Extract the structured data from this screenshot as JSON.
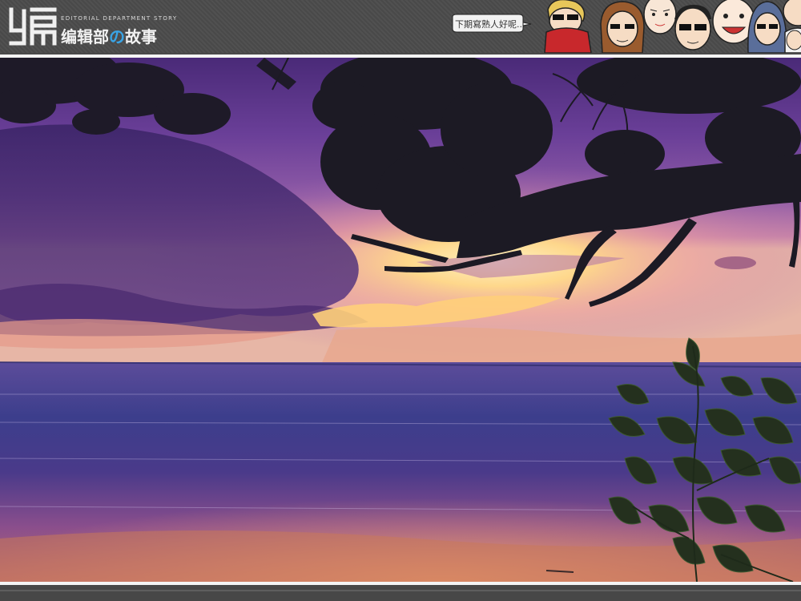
{
  "header": {
    "logo_char": "编",
    "tagline": "EDITORIAL DEPARTMENT STORY",
    "title_part1": "编辑部",
    "title_accent": "の",
    "title_part2": "故事",
    "speech_bubble": "下期寫熟人好呢...",
    "characters_icon": "cartoon-editors-icon"
  },
  "photo": {
    "subject_icon": "sunset-beach-photo",
    "colors": {
      "sky_top": "#4b2a78",
      "sky_mid": "#8a5aa8",
      "horizon_glow": "#ffd98a",
      "sea": "#3b3f8a",
      "sand": "#c9785a"
    }
  }
}
